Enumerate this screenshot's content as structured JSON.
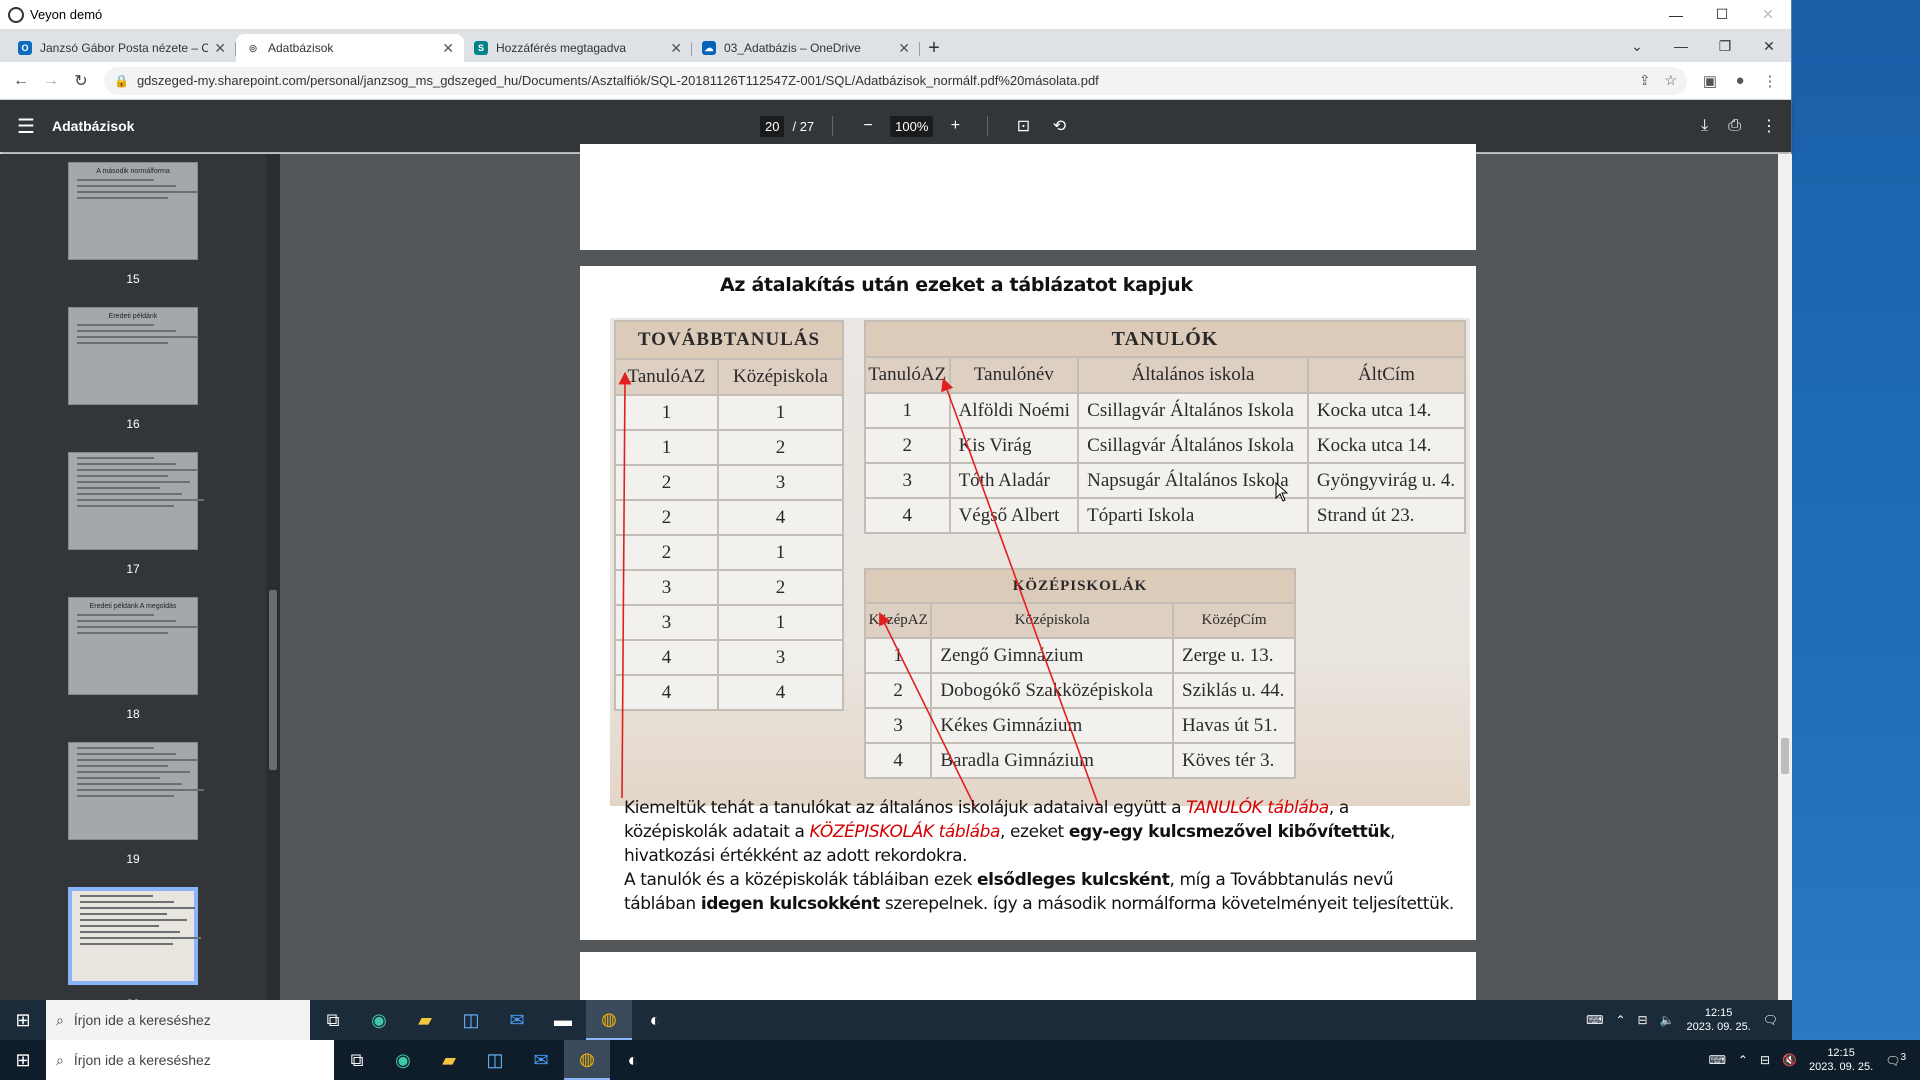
{
  "remote_window": {
    "title": "Veyon demó",
    "controls": [
      "—",
      "☐",
      "✕"
    ]
  },
  "browser": {
    "tabs": [
      {
        "label": "Janzsó Gábor Posta nézete – Ou",
        "icon": "outlook-icon",
        "color": "#0f6cbd",
        "glyph": "O"
      },
      {
        "label": "Adatbázisok",
        "icon": "globe-icon",
        "color": "#555555",
        "glyph": "◎",
        "active": true
      },
      {
        "label": "Hozzáférés megtagadva",
        "icon": "sharepoint-icon",
        "color": "#038387",
        "glyph": "S"
      },
      {
        "label": "03_Adatbázis – OneDrive",
        "icon": "onedrive-icon",
        "color": "#0364b8",
        "glyph": "☁"
      }
    ],
    "url": "gdszeged-my.sharepoint.com/personal/janzsog_ms_gdszeged_hu/Documents/Asztalfiók/SQL-20181126T112547Z-001/SQL/Adatbázisok_normálf.pdf%20másolata.pdf"
  },
  "pdf": {
    "title": "Adatbázisok",
    "page": "20",
    "page_total": "/ 27",
    "zoom": "100%",
    "thumbnails": [
      {
        "num": "15",
        "title": "A második normálforma"
      },
      {
        "num": "16",
        "title": "Eredeti példánk"
      },
      {
        "num": "17",
        "title": ""
      },
      {
        "num": "18",
        "title": "Eredeti példánk A megoldás"
      },
      {
        "num": "19",
        "title": ""
      },
      {
        "num": "20",
        "title": "",
        "active": true
      }
    ]
  },
  "slide": {
    "heading": "Az átalakítás után ezeket a táblázatot kapjuk",
    "tovabb": {
      "caption": "TOVÁBBTANULÁS",
      "headers": [
        "TanulóAZ",
        "Középiskola"
      ],
      "rows": [
        [
          "1",
          "1"
        ],
        [
          "1",
          "2"
        ],
        [
          "2",
          "3"
        ],
        [
          "2",
          "4"
        ],
        [
          "2",
          "1"
        ],
        [
          "3",
          "2"
        ],
        [
          "3",
          "1"
        ],
        [
          "4",
          "3"
        ],
        [
          "4",
          "4"
        ]
      ]
    },
    "tanulok": {
      "caption": "TANULÓK",
      "headers": [
        "TanulóAZ",
        "Tanulónév",
        "Általános iskola",
        "ÁltCím"
      ],
      "rows": [
        [
          "1",
          "Alföldi Noémi",
          "Csillagvár Általános Iskola",
          "Kocka utca 14."
        ],
        [
          "2",
          "Kis Virág",
          "Csillagvár Általános Iskola",
          "Kocka utca 14."
        ],
        [
          "3",
          "Tóth Aladár",
          "Napsugár Általános Iskola",
          "Gyöngyvirág u. 4."
        ],
        [
          "4",
          "Végső Albert",
          "Tóparti Iskola",
          "Strand út 23."
        ]
      ]
    },
    "kozep": {
      "caption": "KÖZÉPISKOLÁK",
      "headers": [
        "KözépAZ",
        "Középiskola",
        "KözépCím"
      ],
      "rows": [
        [
          "1",
          "Zengő Gimnázium",
          "Zerge u. 13."
        ],
        [
          "2",
          "Dobogókő Szakközépiskola",
          "Sziklás u. 44."
        ],
        [
          "3",
          "Kékes Gimnázium",
          "Havas út 51."
        ],
        [
          "4",
          "Baradla Gimnázium",
          "Köves tér 3."
        ]
      ]
    },
    "para": {
      "s1": "Kiemeltük tehát a tanulókat az általános iskolájuk adataival együtt a ",
      "s2": "TANULÓK táblába",
      "s3": ", a középiskolák adatait a ",
      "s4": "KÖZÉPISKOLÁK táblába",
      "s5": ", ezeket ",
      "s6": "egy-egy kulcsmezővel kibővítettük",
      "s7": ", hivatkozási értékként az adott rekordokra.",
      "s8": "A tanulók és a középiskolák tábláiban ezek ",
      "s9": "elsődleges kulcsként",
      "s10": ", míg a Továbbtanulás nevű táblában ",
      "s11": "idegen kulcsokként",
      "s12": " szerepelnek. így a második normálforma követelményeit teljesítettük."
    }
  },
  "remote_taskbar": {
    "search": "Írjon ide a kereséshez",
    "time": "12:15",
    "date": "2023. 09. 25."
  },
  "local_taskbar": {
    "search": "Írjon ide a kereséshez",
    "time": "12:15",
    "date": "2023. 09. 25.",
    "notif": "3"
  }
}
